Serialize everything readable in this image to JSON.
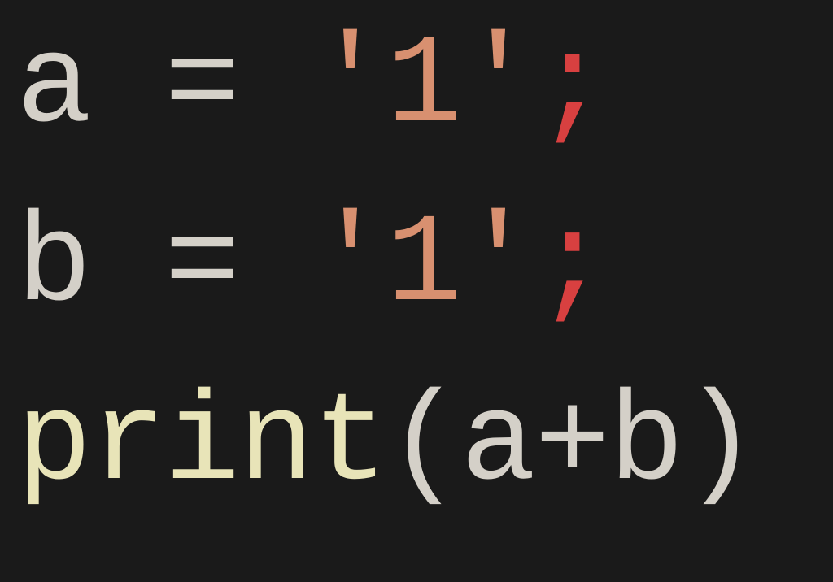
{
  "code": {
    "line1": {
      "var": "a",
      "assign": " = ",
      "string": "'1'",
      "semi": ";"
    },
    "line2": {
      "var": "b",
      "assign": " = ",
      "string": "'1'",
      "semi": ";"
    },
    "line3": {
      "func": "print",
      "lparen": "(",
      "arg1": "a",
      "plus": "+",
      "arg2": "b",
      "rparen": ")"
    }
  }
}
